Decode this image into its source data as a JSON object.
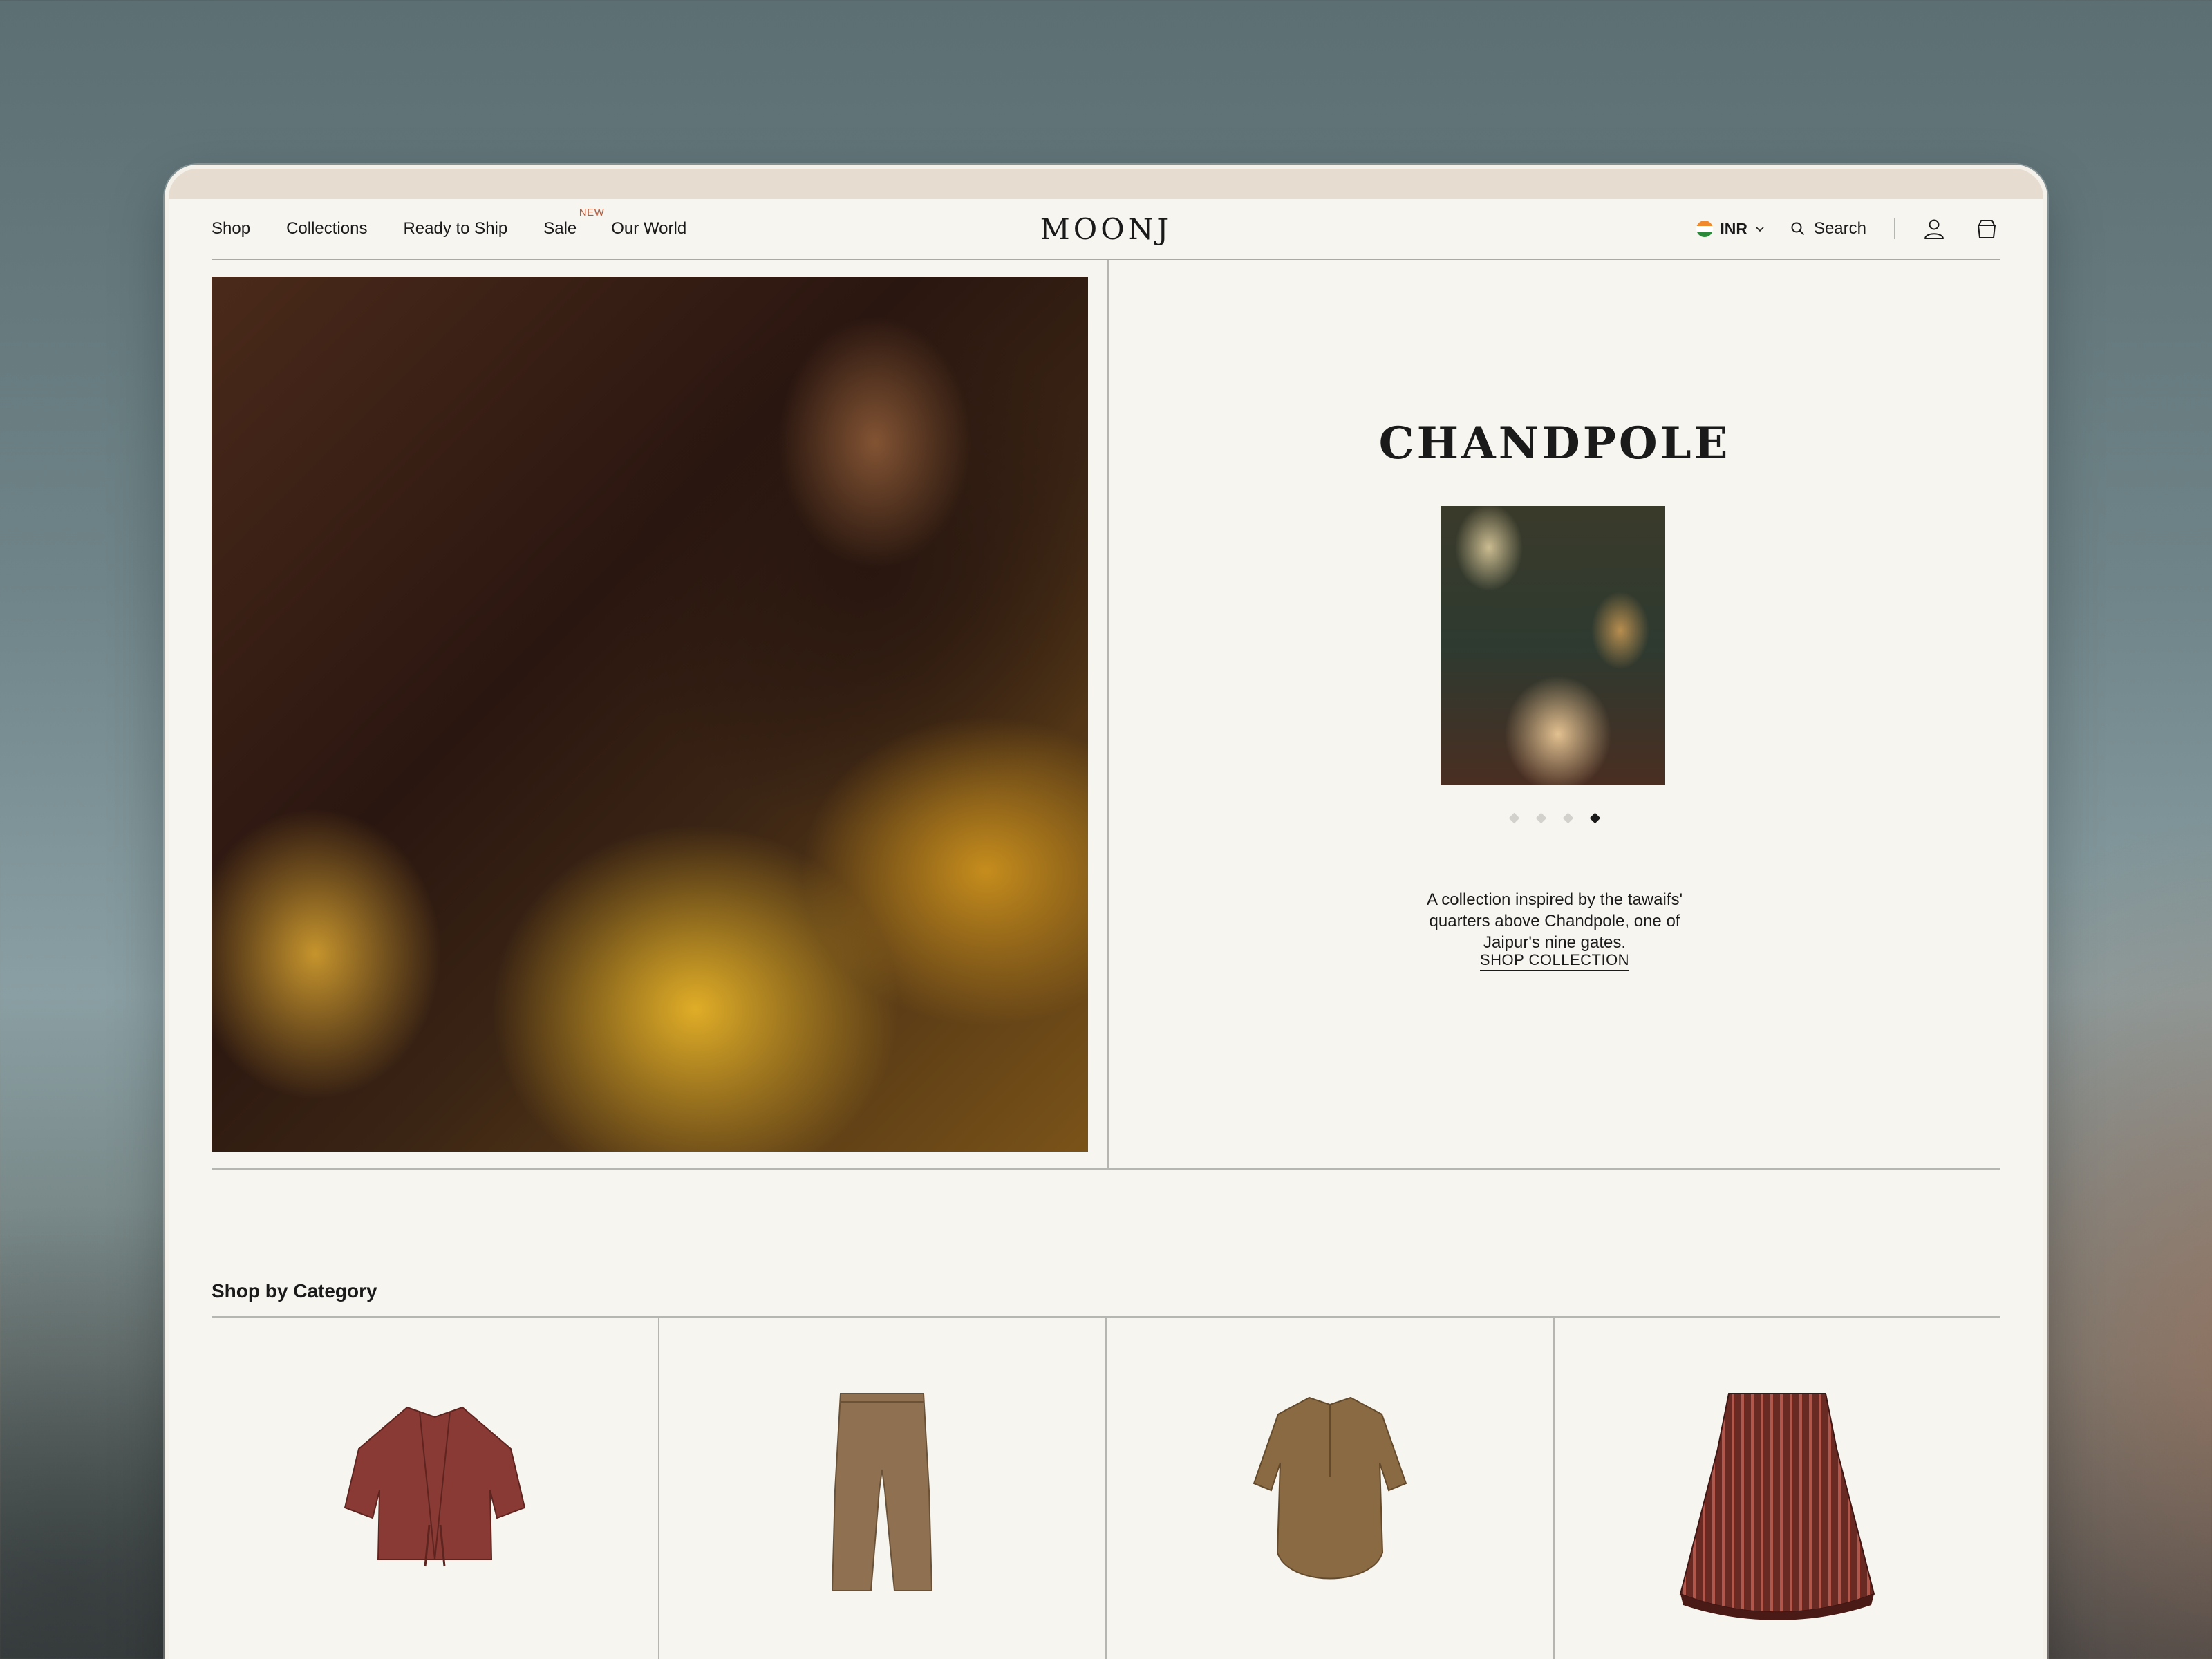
{
  "nav": {
    "links": [
      {
        "label": "Shop"
      },
      {
        "label": "Collections"
      },
      {
        "label": "Ready to Ship"
      },
      {
        "label": "Sale",
        "badge": "NEW"
      },
      {
        "label": "Our World"
      }
    ],
    "logo": "MOONJ",
    "currency": "INR",
    "search_label": "Search",
    "icons": [
      "flag-india-icon",
      "chevron-down-icon",
      "search-icon",
      "user-icon",
      "bag-icon"
    ]
  },
  "hero": {
    "collection_title": "CHANDPOLE",
    "description_lines": [
      "A collection inspired by the tawaifs'",
      "quarters above Chandpole, one of",
      "Jaipur's nine gates."
    ],
    "cta": "SHOP COLLECTION",
    "carousel_dots": 4,
    "carousel_active_index": 3
  },
  "categories": {
    "heading": "Shop by Category",
    "items": [
      {
        "icon": "jacket-icon",
        "color": "#8a3a34"
      },
      {
        "icon": "trousers-icon",
        "color": "#8f7152"
      },
      {
        "icon": "tunic-icon",
        "color": "#8a6a42"
      },
      {
        "icon": "skirt-icon",
        "color": "#6a2a24"
      }
    ]
  },
  "colors": {
    "background": "#f7f5ef",
    "top_strip": "#e6ddd0",
    "text": "#1a1a1a",
    "badge": "#b4583a",
    "divider": "#b5b5b2"
  }
}
